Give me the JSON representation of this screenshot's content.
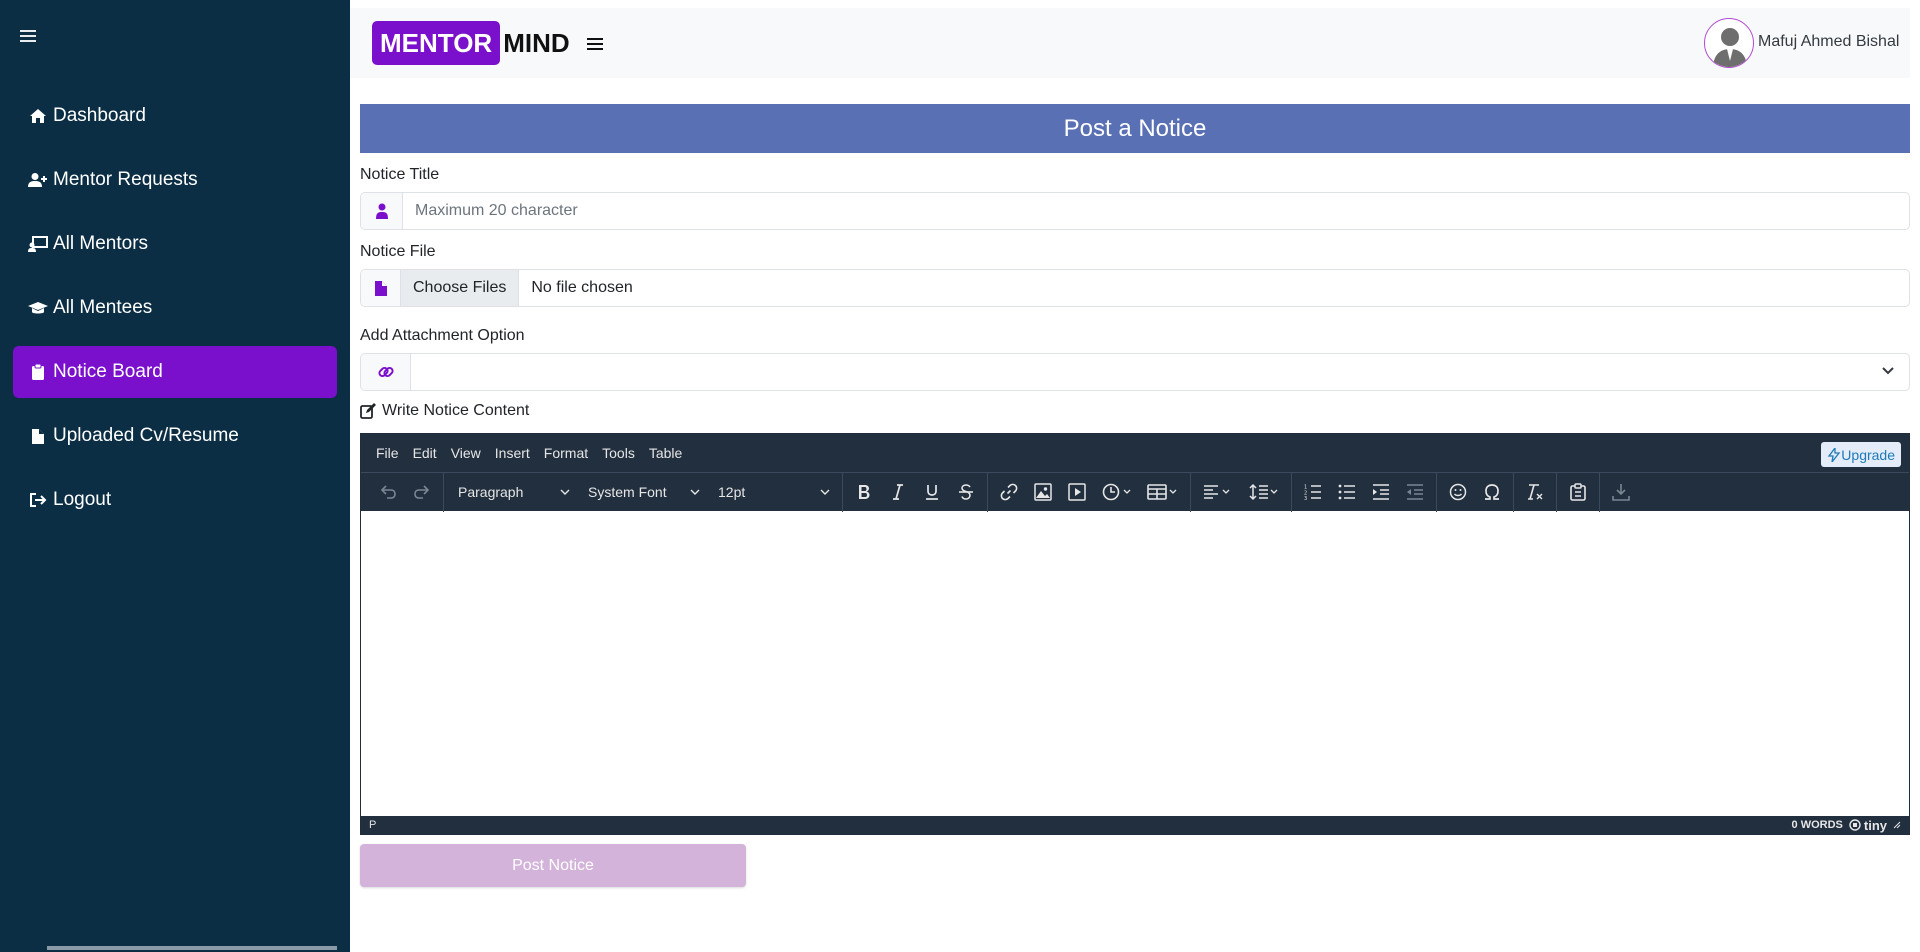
{
  "sidebar": {
    "items": [
      {
        "label": "Dashboard",
        "icon": "home-icon"
      },
      {
        "label": "Mentor Requests",
        "icon": "user-plus-icon"
      },
      {
        "label": "All Mentors",
        "icon": "chalkboard-user-icon"
      },
      {
        "label": "All Mentees",
        "icon": "graduation-cap-icon"
      },
      {
        "label": "Notice Board",
        "icon": "clipboard-icon",
        "active": true
      },
      {
        "label": "Uploaded Cv/Resume",
        "icon": "file-icon"
      },
      {
        "label": "Logout",
        "icon": "logout-icon"
      }
    ],
    "active_color": "#7a0fcc",
    "bg_color": "#0b2e45"
  },
  "header": {
    "logo_part1": "MENTOR",
    "logo_part2": "MIND",
    "user_name": "Mafuj Ahmed Bishal"
  },
  "form": {
    "title": "Post a Notice",
    "notice_title_label": "Notice Title",
    "notice_title_placeholder": "Maximum 20 character",
    "notice_file_label": "Notice File",
    "choose_files": "Choose Files",
    "no_file": "No file chosen",
    "attachment_label": "Add Attachment Option",
    "write_label": "Write Notice Content",
    "submit": "Post Notice"
  },
  "editor": {
    "menu": [
      "File",
      "Edit",
      "View",
      "Insert",
      "Format",
      "Tools",
      "Table"
    ],
    "upgrade": "Upgrade",
    "block_format": "Paragraph",
    "font_family": "System Font",
    "font_size": "12pt",
    "status_path": "P",
    "word_count": "0 WORDS",
    "brand": "tiny"
  }
}
